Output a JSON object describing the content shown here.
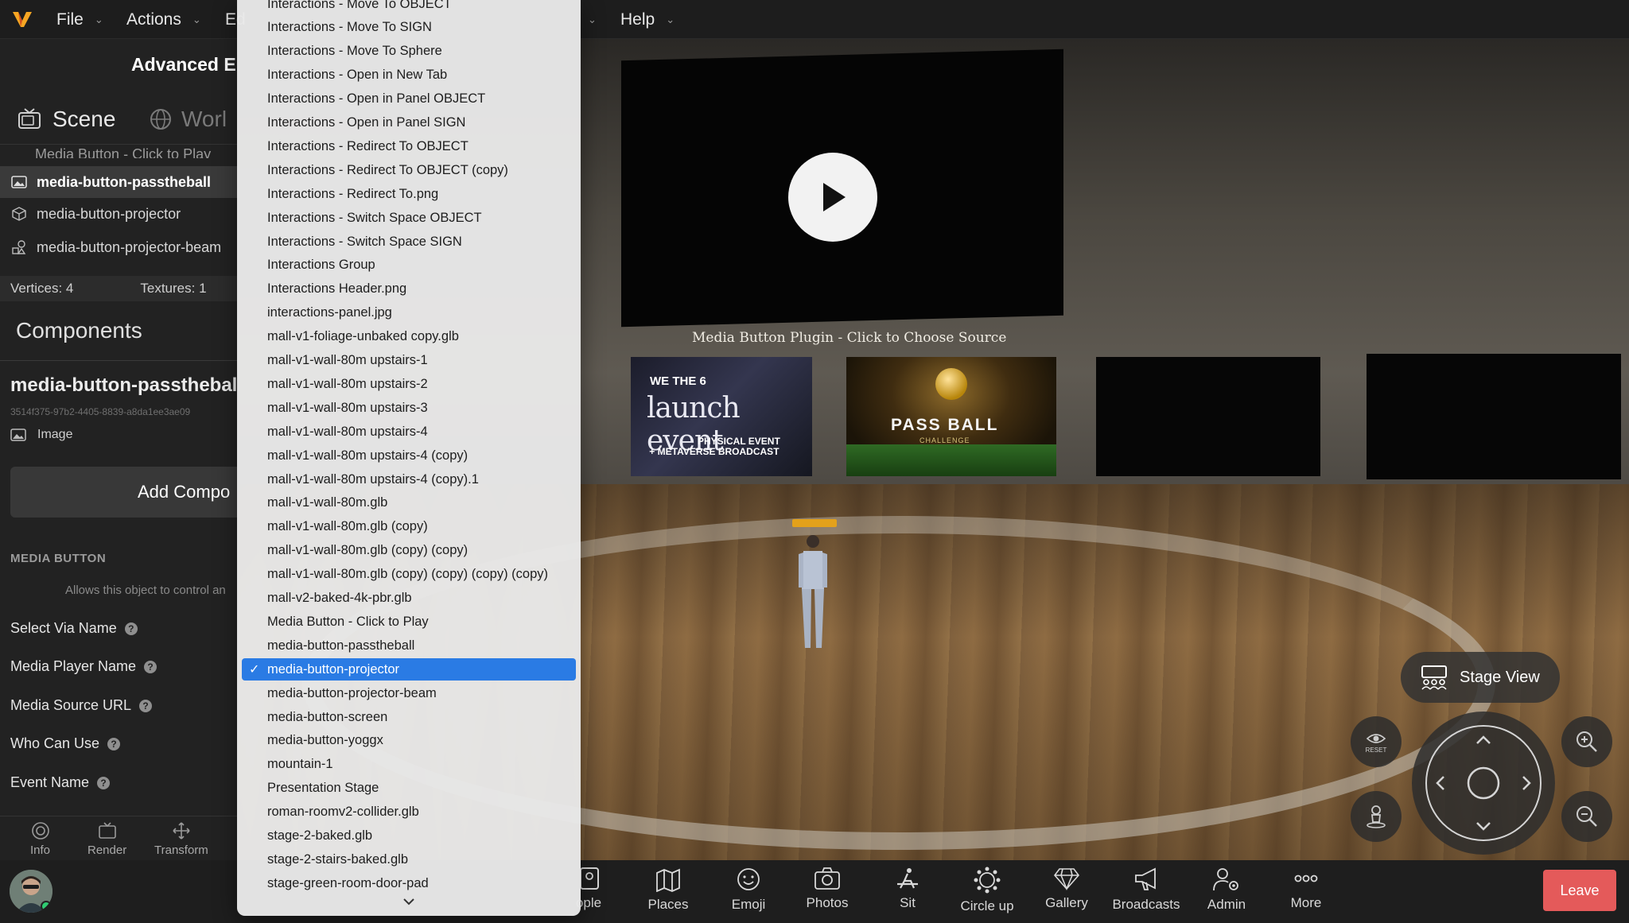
{
  "topbar": {
    "menus": [
      "File",
      "Actions",
      "Ed",
      "Help"
    ]
  },
  "left_panel": {
    "title": "Advanced E",
    "tabs": [
      "Scene",
      "Worl"
    ],
    "tree_partial": "Media Button - Click to Play",
    "tree": [
      {
        "label": "media-button-passtheball",
        "selected": true,
        "icon": "image-icon"
      },
      {
        "label": "media-button-projector",
        "selected": false,
        "icon": "cube-icon"
      },
      {
        "label": "media-button-projector-beam",
        "selected": false,
        "icon": "shapes-icon"
      }
    ],
    "stats": {
      "vertices": "Vertices: 4",
      "textures": "Textures: 1"
    },
    "components_heading": "Components",
    "object_name": "media-button-passtheball",
    "object_id": "3514f375-97b2-4405-8839-a8da1ee3ae09",
    "image_label": "Image",
    "add_component": "Add Compo",
    "section_heading": "MEDIA BUTTON",
    "section_desc": "Allows this object to control an",
    "properties": [
      "Select Via Name",
      "Media Player Name",
      "Media Source URL",
      "Who Can Use",
      "Event Name"
    ],
    "bottom_tabs": [
      "Info",
      "Render",
      "Transform"
    ]
  },
  "dropdown": {
    "items": [
      "Interactions - Move To OBJECT",
      "Interactions - Move To SIGN",
      "Interactions - Move To Sphere",
      "Interactions - Open in New Tab",
      "Interactions - Open in Panel OBJECT",
      "Interactions - Open in Panel SIGN",
      "Interactions - Redirect To OBJECT",
      "Interactions - Redirect To OBJECT (copy)",
      "Interactions - Redirect To.png",
      "Interactions - Switch Space OBJECT",
      "Interactions - Switch Space SIGN",
      "Interactions Group",
      "Interactions Header.png",
      "interactions-panel.jpg",
      "mall-v1-foliage-unbaked copy.glb",
      "mall-v1-wall-80m upstairs-1",
      "mall-v1-wall-80m upstairs-2",
      "mall-v1-wall-80m upstairs-3",
      "mall-v1-wall-80m upstairs-4",
      "mall-v1-wall-80m upstairs-4 (copy)",
      "mall-v1-wall-80m upstairs-4 (copy).1",
      "mall-v1-wall-80m.glb",
      "mall-v1-wall-80m.glb (copy)",
      "mall-v1-wall-80m.glb (copy) (copy)",
      "mall-v1-wall-80m.glb (copy) (copy) (copy) (copy)",
      "mall-v2-baked-4k-pbr.glb",
      "Media Button - Click to Play",
      "media-button-passtheball",
      "media-button-projector",
      "media-button-projector-beam",
      "media-button-screen",
      "media-button-yoggx",
      "mountain-1",
      "Presentation Stage",
      "roman-roomv2-collider.glb",
      "stage-2-baked.glb",
      "stage-2-stairs-baked.glb",
      "stage-green-room-door-pad"
    ],
    "selected_index": 28,
    "check": "✓"
  },
  "viewport": {
    "caption": "Media Button Plugin - Click to Choose Source",
    "poster1": {
      "line1": "WE THE 6",
      "line2": "launch event",
      "line3": "PHYSICAL EVENT",
      "line4": "+ METAVERSE BROADCAST"
    },
    "poster2": {
      "title": "PASS BALL",
      "subtitle": "CHALLENGE"
    },
    "stage_view": "Stage View",
    "reset_label": "RESET"
  },
  "bottombar": {
    "items": [
      "ople",
      "Places",
      "Emoji",
      "Photos",
      "Sit",
      "Circle up",
      "Gallery",
      "Broadcasts",
      "Admin",
      "More"
    ],
    "leave": "Leave"
  },
  "colors": {
    "accent": "#2a7be4",
    "leave": "#e45a5a",
    "logo": "#f5a623"
  }
}
